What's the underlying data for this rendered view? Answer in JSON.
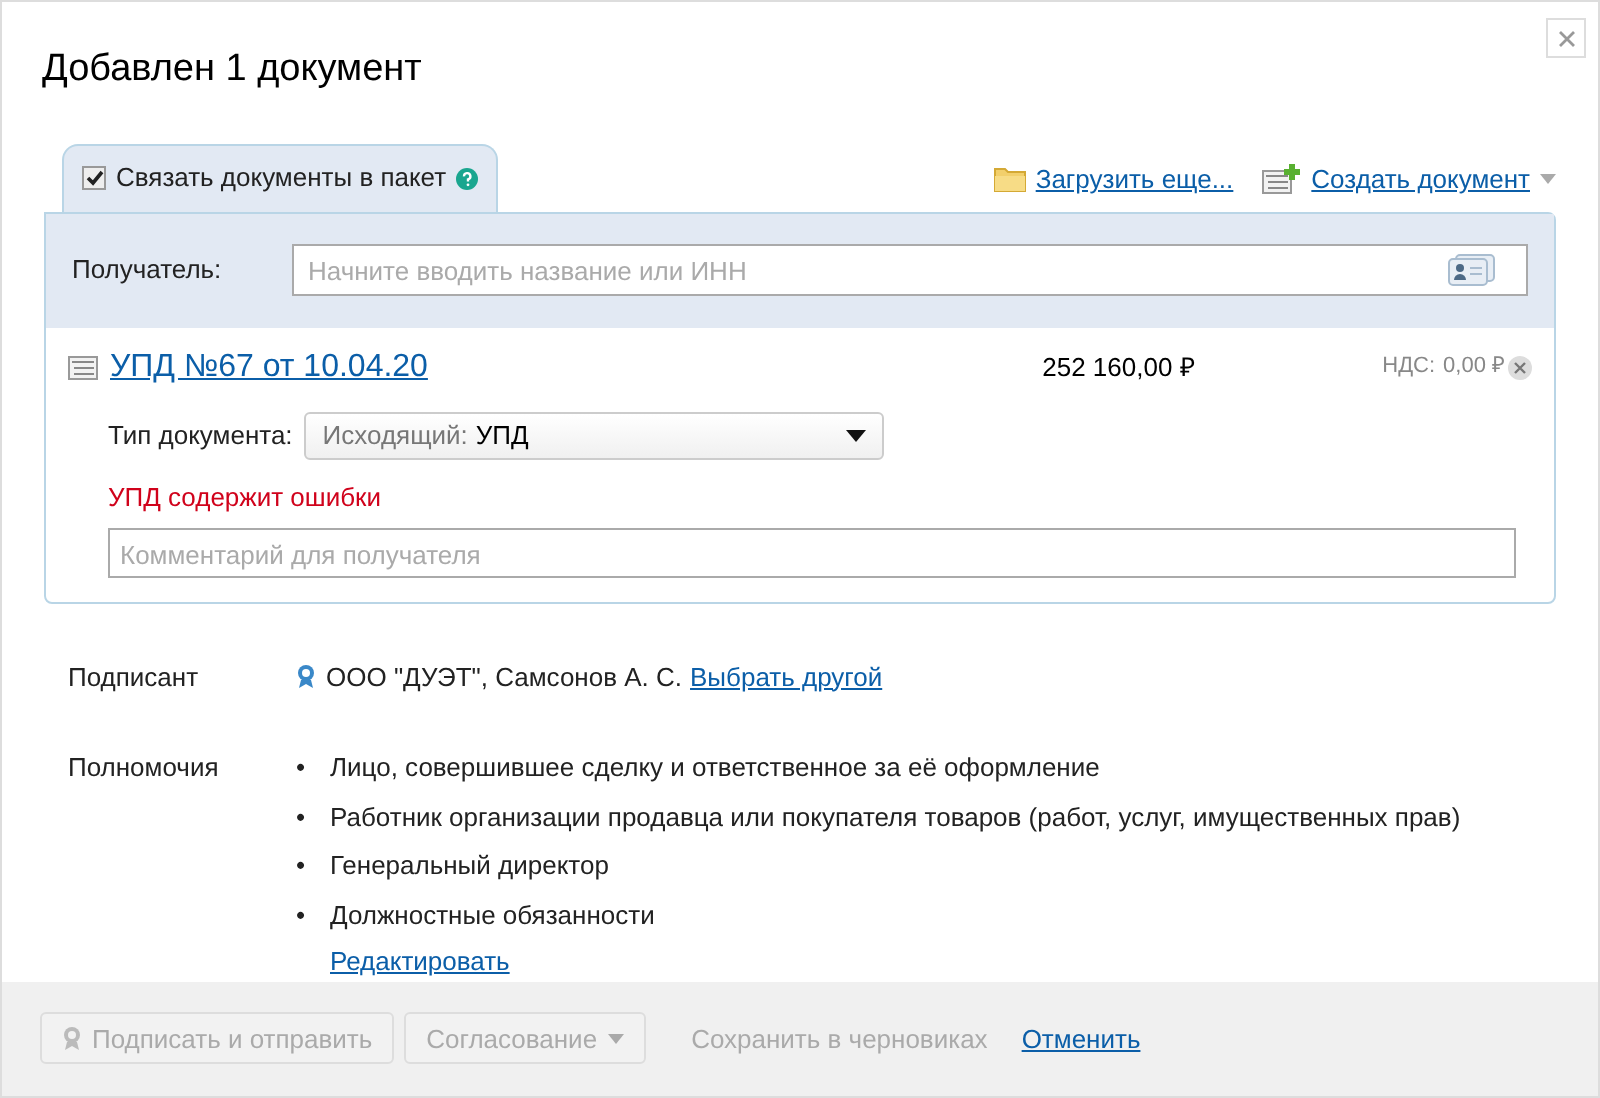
{
  "dialog": {
    "title": "Добавлен 1 документ"
  },
  "package_tab": {
    "label": "Связать документы в пакет",
    "checked": true,
    "selected": true
  },
  "actions": [
    {
      "kind": "upload",
      "label": "Загрузить еще..."
    },
    {
      "kind": "create",
      "label": "Создать документ"
    }
  ],
  "recipient": {
    "label": "Получатель:",
    "placeholder": "Начните вводить название или ИНН"
  },
  "document": {
    "title": "УПД №67 от 10.04.20",
    "amount": "252 160,00 ₽",
    "vat_label": "НДС:",
    "vat": "0,00 ₽",
    "type_label": "Тип документа:",
    "type_prefix": "Исходящий:",
    "type_value": "УПД",
    "error": "УПД содержит ошибки",
    "comment_placeholder": "Комментарий для получателя"
  },
  "signer": {
    "label": "Подписант",
    "value": "ООО \"ДУЭТ\", Самсонов А. С.",
    "link": "Выбрать другой"
  },
  "powers": {
    "label": "Полномочия",
    "marker": "•",
    "items": [
      "Лицо, совершившее сделку и ответственное за её оформление",
      "Работник организации продавца или покупателя товаров (работ, услуг, имущественных прав)",
      "Генеральный директор",
      "Должностные обязанности"
    ],
    "link": "Редактировать"
  },
  "footer": [
    {
      "kind": "sign",
      "label": "Подписать и отправить",
      "disabled": true
    },
    {
      "kind": "dropdown",
      "label": "Согласование",
      "disabled": true
    },
    {
      "kind": "text",
      "label": "Сохранить в черновиках",
      "disabled": true
    },
    {
      "kind": "link",
      "label": "Отменить",
      "disabled": false
    }
  ]
}
